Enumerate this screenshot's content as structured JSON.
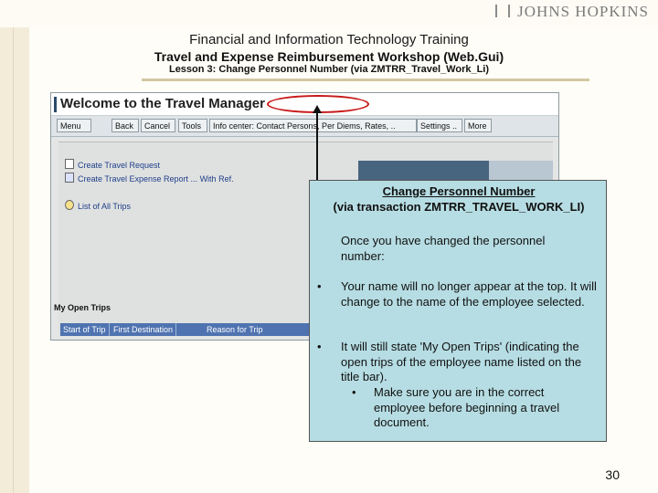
{
  "header": {
    "logo_text": "JOHNS HOPKINS",
    "title": "Financial and Information Technology Training",
    "subtitle": "Travel and Expense Reimbursement Workshop (Web.Gui)",
    "lesson": "Lesson 3: Change Personnel Number (via ZMTRR_Travel_Work_Li)"
  },
  "sap": {
    "title": "Welcome to the Travel Manager",
    "toolbar": [
      "Menu",
      "Back",
      "Cancel",
      "Tools",
      "Info center: Contact Persons, Per Diems, Rates, ..",
      "Settings ..",
      "More"
    ],
    "tasks": [
      "Create Travel Request",
      "Create Travel Expense Report ... With Ref.",
      "List of All Trips"
    ],
    "open_trips_label": "My Open Trips",
    "table_columns": [
      "Start of Trip",
      "First Destination",
      "Reason for Trip"
    ]
  },
  "callout": {
    "title": "Change Personnel Number",
    "subtitle": "(via transaction ZMTRR_TRAVEL_WORK_LI)",
    "intro": "Once you have changed the personnel number:",
    "bullets": [
      "Your name will no longer appear at the top. It will change to the name of the employee selected.",
      "It will still state 'My Open Trips' (indicating the open trips of the employee name listed on the title bar)."
    ],
    "sub_bullet": "Make sure you are in the correct employee before beginning a travel document."
  },
  "page_number": "30",
  "colors": {
    "callout_bg": "#b6dde3",
    "highlight_ellipse": "#c81818",
    "sap_table_header": "#4f73b0"
  }
}
